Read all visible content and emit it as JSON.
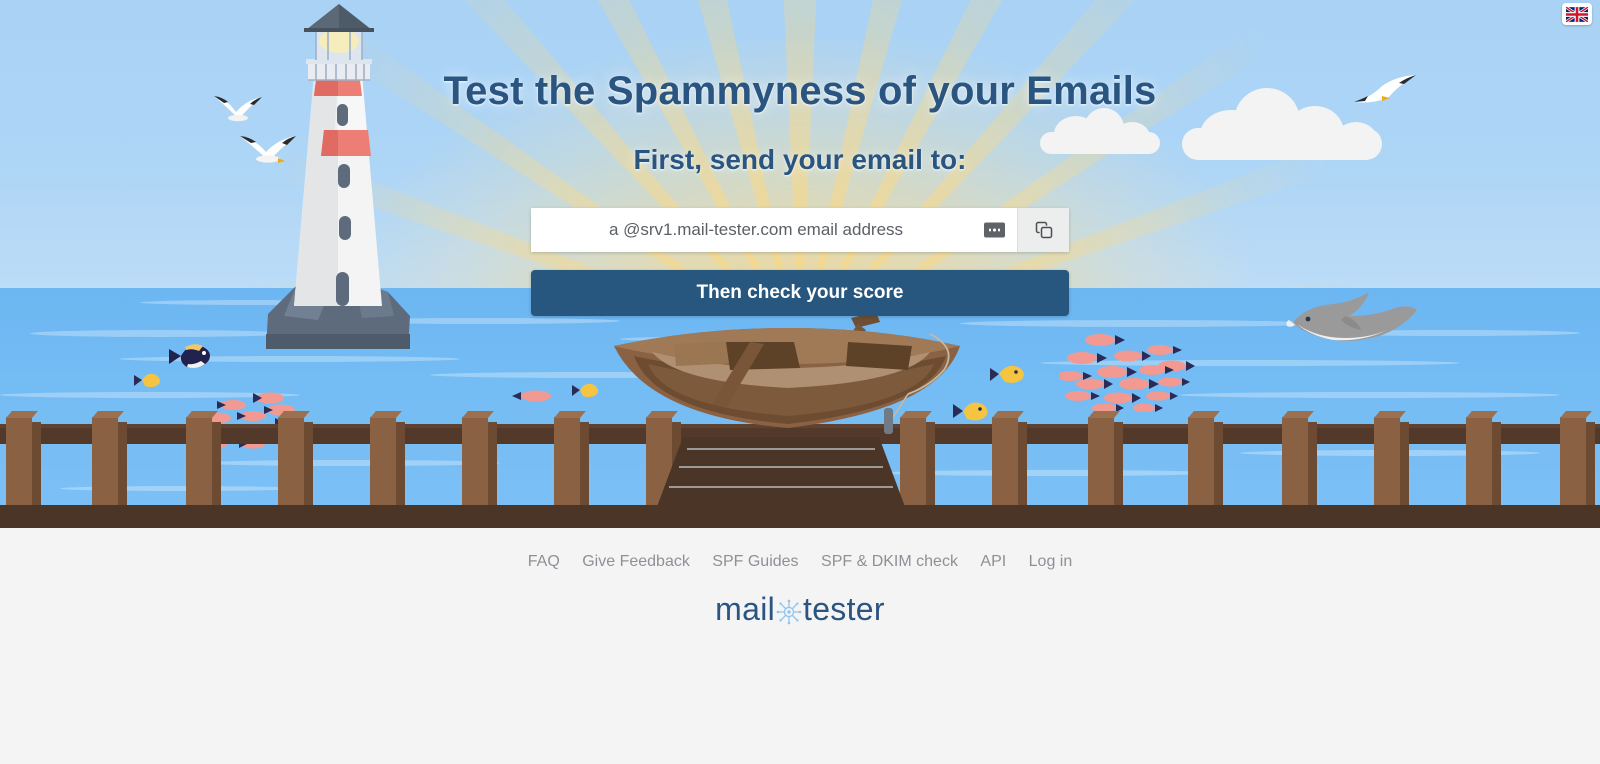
{
  "header": {
    "title": "Test the Spammyness of your Emails",
    "subtitle": "First, send your email to:"
  },
  "language_selector": {
    "icon": "uk-flag-icon",
    "label": "English"
  },
  "form": {
    "email_placeholder": "a @srv1.mail-tester.com email address",
    "email_value": "",
    "options_icon": "ellipsis-icon",
    "copy_icon": "copy-icon",
    "submit_label": "Then check your score"
  },
  "footer": {
    "links": [
      {
        "label": "FAQ"
      },
      {
        "label": "Give Feedback"
      },
      {
        "label": "SPF Guides"
      },
      {
        "label": "SPF & DKIM check"
      },
      {
        "label": "API"
      },
      {
        "label": "Log in"
      }
    ],
    "brand": {
      "left": "mail",
      "right": "tester",
      "icon": "ship-wheel-icon"
    }
  },
  "colors": {
    "accent": "#27567f",
    "title": "#2a5580",
    "sky": "#add5f6",
    "sea": "#74bcf4",
    "deck": "#4a3526",
    "footer_bg": "#f4f4f5",
    "link": "#8d9196"
  },
  "scene": {
    "illustration": "seaside-pier-with-lighthouse-and-rowboat",
    "elements": [
      "lighthouse",
      "rowboat",
      "dolphin",
      "seagulls",
      "clouds",
      "fish-school",
      "pier-fence",
      "sun-rays"
    ]
  }
}
